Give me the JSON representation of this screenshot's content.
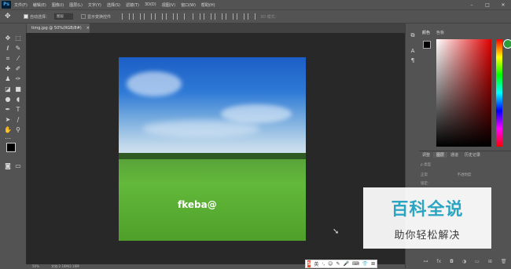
{
  "app": {
    "logo": "Ps"
  },
  "menu": [
    "文件(F)",
    "编辑(E)",
    "图像(I)",
    "图层(L)",
    "文字(Y)",
    "选择(S)",
    "滤镜(T)",
    "3D(D)",
    "视图(V)",
    "窗口(W)",
    "帮助(H)"
  ],
  "window_controls": [
    "–",
    "□",
    "✕"
  ],
  "options": {
    "auto_select_label": "自动选择：",
    "auto_select_value": "图层",
    "transform_label": "显示变换控件",
    "mode_3d_label": "3D 模式："
  },
  "document": {
    "tab_title": "timg.jpg @ 50%(RGB/8#)",
    "close": "×",
    "overlay_text": "fkeba@"
  },
  "color_panel": {
    "tabs": [
      "颜色",
      "色板"
    ]
  },
  "layers_panel": {
    "tabs": [
      "调整",
      "图层",
      "通道",
      "历史记录"
    ],
    "kind_label": "ρ 类型",
    "blend_mode": "正常",
    "opacity_label": "不透明度",
    "lock_label": "锁定："
  },
  "status": {
    "zoom": "50%",
    "doc_info": "文档:2.16M/2.16M"
  },
  "watermark": {
    "title": "百科全说",
    "subtitle": "助你轻松解决"
  },
  "ime": {
    "brand": "S",
    "lang": "英",
    "items": [
      "·,",
      "☺",
      "✎",
      "🎤",
      "⌨",
      "👕",
      "⊞"
    ]
  },
  "icons": {
    "move": "move-icon"
  }
}
